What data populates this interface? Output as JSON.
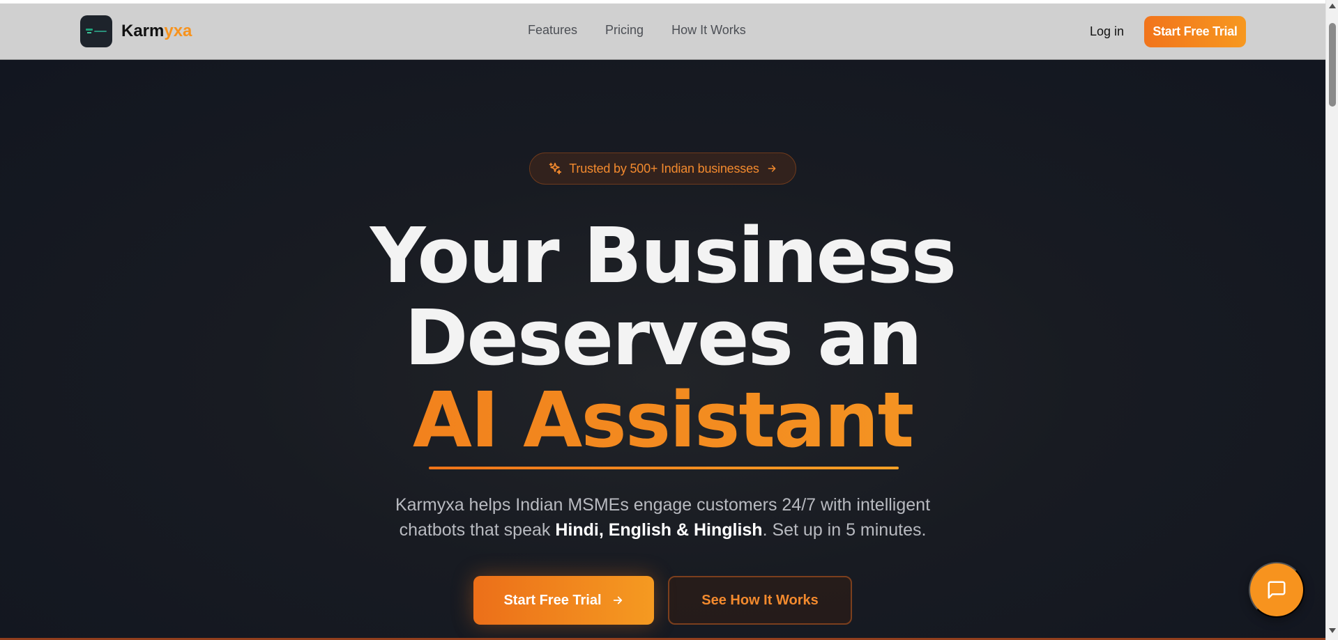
{
  "brand": {
    "name_main": "Karm",
    "name_accent": "yxa",
    "accent_color": "#f7931e"
  },
  "nav": {
    "links": [
      {
        "label": "Features"
      },
      {
        "label": "Pricing"
      },
      {
        "label": "How It Works"
      }
    ],
    "login_label": "Log in",
    "cta_label": "Start Free Trial"
  },
  "hero": {
    "badge": {
      "text": "Trusted by 500+ Indian businesses",
      "icon": "sparkles-icon",
      "arrow_icon": "arrow-right-icon"
    },
    "headline": {
      "line1": "Your Business",
      "line2": "Deserves an",
      "line3": "AI Assistant"
    },
    "subtitle": {
      "part1": "Karmyxa helps Indian MSMEs engage customers 24/7 with intelligent",
      "part2": "chatbots that speak ",
      "emphasis": "Hindi, English & Hinglish",
      "part3": ". Set up in 5 minutes."
    },
    "primary_cta": "Start Free Trial",
    "secondary_cta": "See How It Works"
  },
  "chat_widget": {
    "icon": "chat-bubble-icon"
  },
  "colors": {
    "orange": "#f7931e",
    "orange_dark": "#ec6f19",
    "dark_bg": "#121620",
    "navbar_bg": "#d0d0d0"
  }
}
